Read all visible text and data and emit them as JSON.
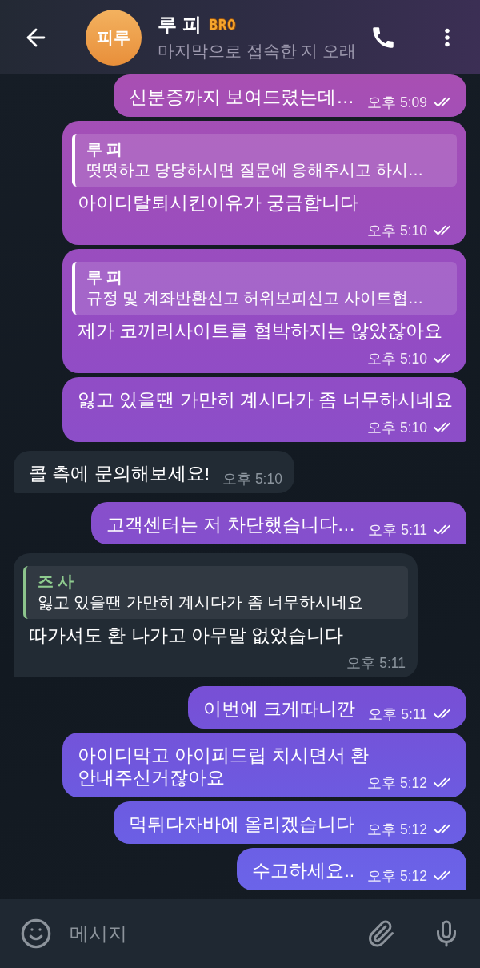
{
  "header": {
    "avatar_initials": "피루",
    "name": "루 피",
    "name_tag": "BRO",
    "status": "마지막으로 접속한 지 오래"
  },
  "messages": [
    {
      "kind": "outgoing",
      "text": "신분증까지 보여드렸는데…",
      "time": "오후 5:09",
      "read": true
    },
    {
      "kind": "outgoing",
      "reply": {
        "author": "루 피",
        "text": "떳떳하고 당당하시면 질문에 응해주시고 하시…"
      },
      "text": "아이디탈퇴시킨이유가 궁금합니다",
      "time": "오후 5:10",
      "read": true
    },
    {
      "kind": "outgoing",
      "reply": {
        "author": "루 피",
        "text": "규정 및 계좌반환신고 허위보피신고 사이트협…"
      },
      "text": "제가 코끼리사이트를 협박하지는 않았잖아요",
      "time": "오후 5:10",
      "read": true
    },
    {
      "kind": "outgoing",
      "text": "잃고 있을땐 가만히 계시다가 좀 너무하시네요",
      "time": "오후 5:10",
      "read": true
    },
    {
      "kind": "incoming",
      "text": "콜 측에 문의해보세요!",
      "time": "오후 5:10"
    },
    {
      "kind": "outgoing",
      "text": "고객센터는 저 차단했습니다…",
      "time": "오후 5:11",
      "read": true
    },
    {
      "kind": "incoming",
      "reply": {
        "author": "즈 사",
        "text": "잃고 있을땐 가만히 계시다가 좀 너무하시네요"
      },
      "text": "따가셔도 환 나가고 아무말 없었습니다",
      "time": "오후 5:11"
    },
    {
      "kind": "outgoing",
      "text": "이번에 크게따니깐",
      "time": "오후 5:11",
      "read": true
    },
    {
      "kind": "outgoing",
      "text": "아이디막고 아이피드립 치시면서 환 안내주신거잖아요",
      "time": "오후 5:12",
      "read": true
    },
    {
      "kind": "outgoing",
      "text": "먹튀다자바에 올리겠습니다",
      "time": "오후 5:12",
      "read": true
    },
    {
      "kind": "outgoing",
      "text": "수고하세요..",
      "time": "오후 5:12",
      "read": true
    }
  ],
  "composer": {
    "placeholder": "메시지"
  }
}
